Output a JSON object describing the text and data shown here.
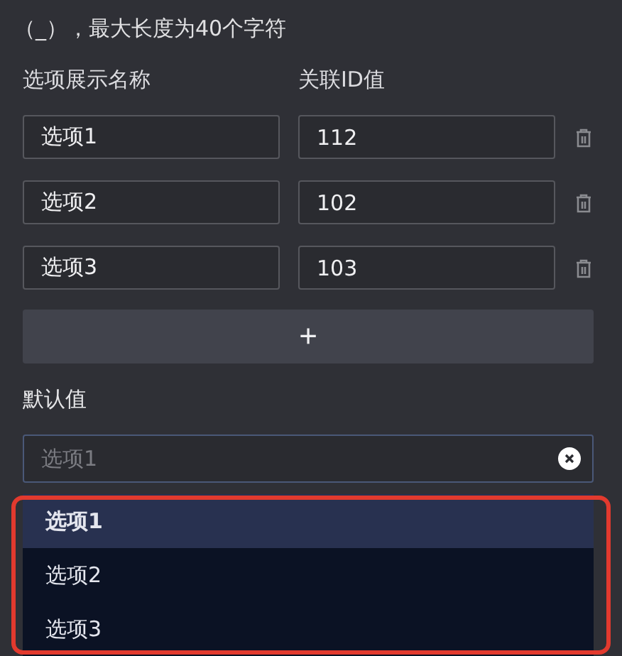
{
  "hint": "（_），最大长度为40个字符",
  "columns": [
    "选项展示名称",
    "关联ID值"
  ],
  "options": [
    {
      "name": "选项1",
      "id": "112"
    },
    {
      "name": "选项2",
      "id": "102"
    },
    {
      "name": "选项3",
      "id": "103"
    }
  ],
  "add_button": "+",
  "default_value": {
    "label": "默认值",
    "placeholder": "选项1"
  },
  "dropdown": [
    {
      "label": "选项1",
      "selected": true
    },
    {
      "label": "选项2",
      "selected": false
    },
    {
      "label": "选项3",
      "selected": false
    }
  ]
}
